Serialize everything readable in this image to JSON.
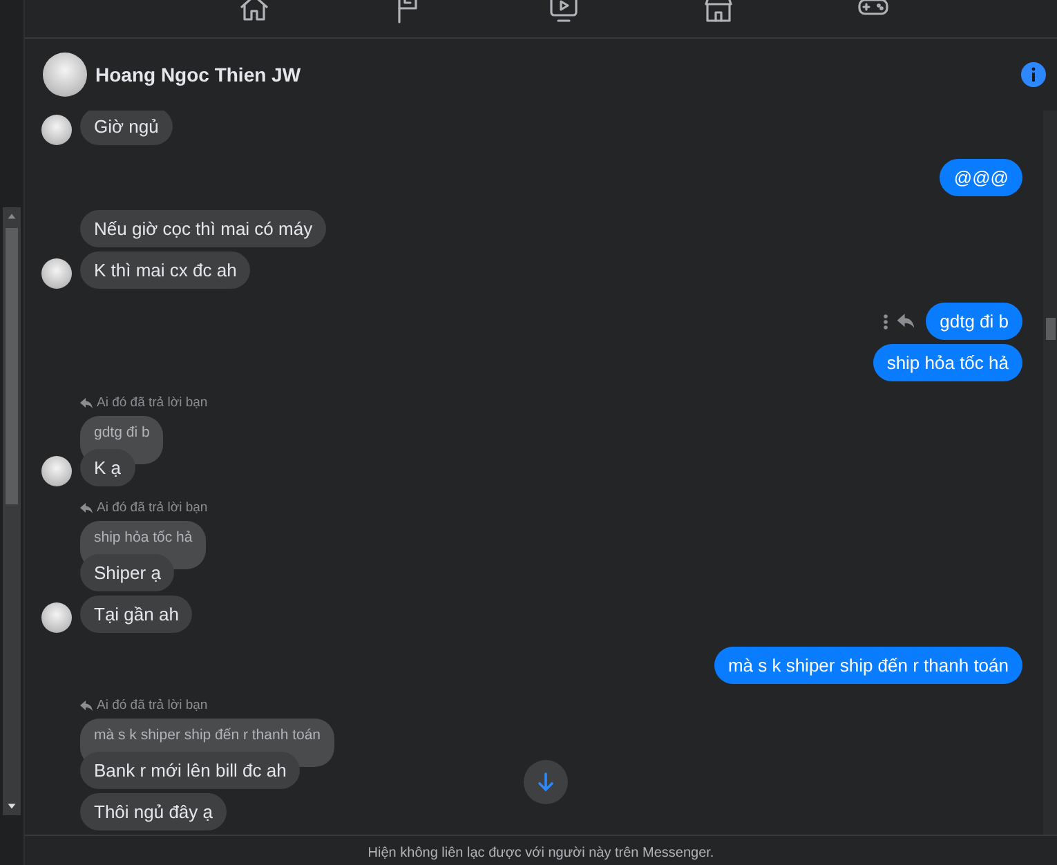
{
  "contact": {
    "name": "Hoang Ngoc Thien JW"
  },
  "groups": [
    {
      "kind": "incoming",
      "avatar": true,
      "messages": [
        {
          "text": "Giờ ngủ",
          "actions": false
        }
      ]
    },
    {
      "kind": "outgoing",
      "avatar": false,
      "messages": [
        {
          "text": "@@@",
          "actions": false
        }
      ]
    },
    {
      "kind": "incoming",
      "avatar": true,
      "messages": [
        {
          "text": "Nếu giờ cọc thì mai có máy",
          "actions": false
        },
        {
          "text": "K thì mai cx đc ah",
          "actions": false
        }
      ]
    },
    {
      "kind": "outgoing",
      "avatar": false,
      "messages": [
        {
          "text": "gdtg đi b",
          "actions": true
        },
        {
          "text": "ship hỏa tốc hả",
          "actions": false
        }
      ]
    },
    {
      "kind": "incoming",
      "avatar": true,
      "reply_note": "Ai đó đã trả lời bạn",
      "quote": "gdtg đi b",
      "messages": [
        {
          "text": "K ạ",
          "actions": false
        }
      ]
    },
    {
      "kind": "incoming",
      "avatar": true,
      "reply_note": "Ai đó đã trả lời bạn",
      "quote": "ship hỏa tốc hả",
      "messages": [
        {
          "text": "Shiper ạ",
          "actions": false
        },
        {
          "text": "Tại gần ah",
          "actions": false
        }
      ]
    },
    {
      "kind": "outgoing",
      "avatar": false,
      "messages": [
        {
          "text": "mà s k shiper ship đến r thanh toán",
          "actions": false
        }
      ]
    },
    {
      "kind": "incoming",
      "avatar": false,
      "reply_note": "Ai đó đã trả lời bạn",
      "quote": "mà s k shiper ship đến r thanh toán",
      "messages": [
        {
          "text": "Bank r mới lên bill đc ah",
          "actions": false
        },
        {
          "text": "Thôi ngủ đây ạ",
          "actions": false
        }
      ]
    }
  ],
  "footer": {
    "notice": "Hiện không liên lạc được với người này trên Messenger."
  }
}
